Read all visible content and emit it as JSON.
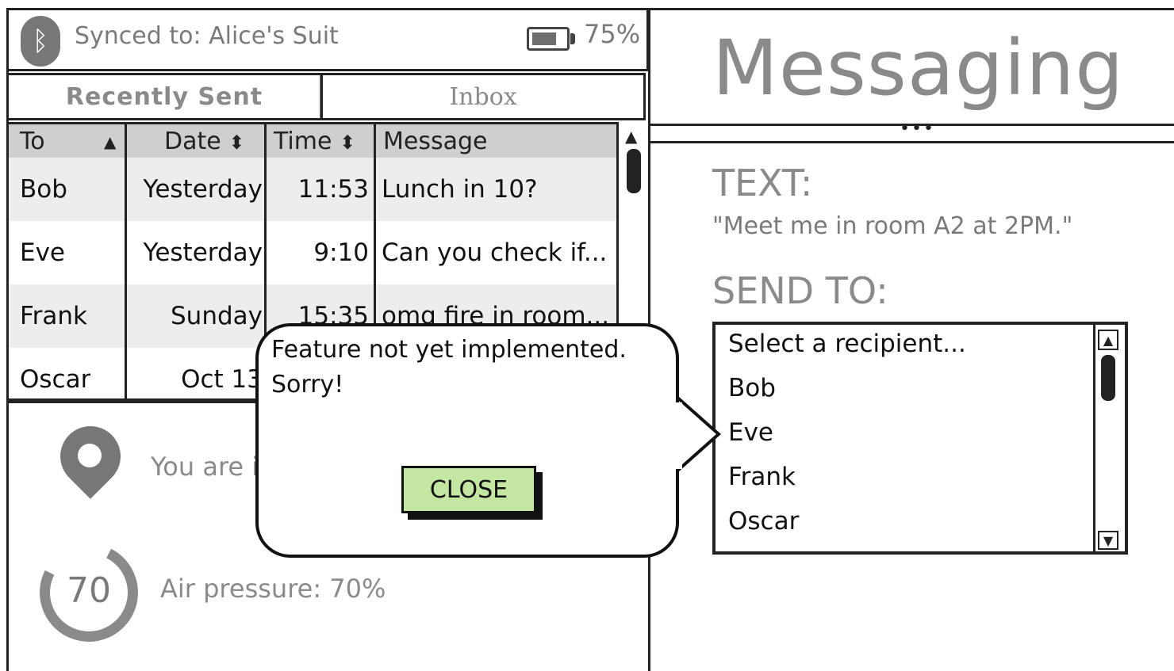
{
  "status": {
    "bluetooth_glyph": "ᛒ",
    "sync_text": "Synced to: Alice's Suit",
    "battery_percent_label": "75%",
    "battery_level": 0.75
  },
  "tabs": [
    {
      "label": "Recently Sent"
    },
    {
      "label": "Inbox"
    }
  ],
  "table": {
    "headers": [
      {
        "label": "To",
        "sort": "▲"
      },
      {
        "label": "Date",
        "sort": "⬍"
      },
      {
        "label": "Time",
        "sort": "⬍"
      },
      {
        "label": "Message",
        "sort": ""
      }
    ],
    "rows": [
      {
        "to": "Bob",
        "date": "Yesterday",
        "time": "11:53",
        "message": "Lunch in 10?"
      },
      {
        "to": "Eve",
        "date": "Yesterday",
        "time": "9:10",
        "message": "Can you check if..."
      },
      {
        "to": "Frank",
        "date": "Sunday",
        "time": "15:35",
        "message": "omg fire in room..."
      },
      {
        "to": "Oscar",
        "date": "Oct 13",
        "time": "",
        "message": ""
      }
    ]
  },
  "location": {
    "icon": "map-pin-icon",
    "text": "You are i"
  },
  "pressure": {
    "gauge_value": "70",
    "text": "Air pressure: 70%"
  },
  "compose": {
    "title": "Messaging",
    "dots": "•••",
    "text_label": "TEXT:",
    "text_value": "\"Meet me in room A2 at 2PM.\"",
    "sendto_label": "SEND TO:",
    "recipients": [
      "Select a recipient...",
      "Bob",
      "Eve",
      "Frank",
      "Oscar"
    ]
  },
  "callout": {
    "line1": "Feature not yet implemented.",
    "line2": "Sorry!",
    "close_label": "CLOSE"
  },
  "colors": {
    "close_button": "#c3e6a3",
    "muted_text": "#8a8a8a"
  }
}
